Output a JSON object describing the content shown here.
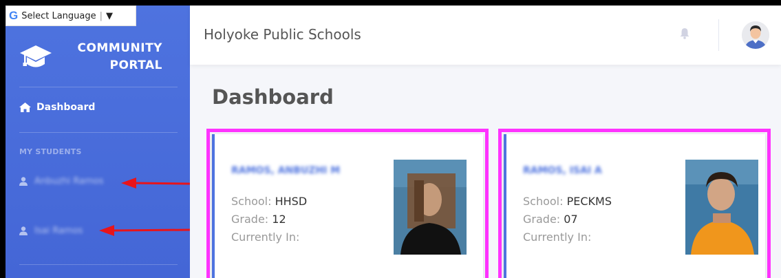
{
  "translate": {
    "label": "Select Language",
    "caret": "▼",
    "logo": "G"
  },
  "sidebar": {
    "brand_line1": "COMMUNITY",
    "brand_line2": "PORTAL",
    "nav_dashboard": "Dashboard",
    "section_students": "MY STUDENTS",
    "students": [
      {
        "label": "Anbuzhi Ramos"
      },
      {
        "label": "Isai Ramos"
      }
    ]
  },
  "header": {
    "org_title": "Holyoke Public Schools"
  },
  "main": {
    "page_title": "Dashboard",
    "cards": [
      {
        "name": "RAMOS, ANBUZHI M",
        "school_label": "School:",
        "school": "HHSD",
        "grade_label": "Grade:",
        "grade": "12",
        "location_label": "Currently In:",
        "location": ""
      },
      {
        "name": "RAMOS, ISAI A",
        "school_label": "School:",
        "school": "PECKMS",
        "grade_label": "Grade:",
        "grade": "07",
        "location_label": "Currently In:",
        "location": ""
      }
    ]
  },
  "colors": {
    "primary": "#4e73df",
    "highlight": "#ff33ff",
    "arrow": "#e8141a"
  },
  "icons": [
    "google-icon",
    "graduation-cap-icon",
    "home-icon",
    "user-icon",
    "bell-icon",
    "avatar-icon"
  ]
}
